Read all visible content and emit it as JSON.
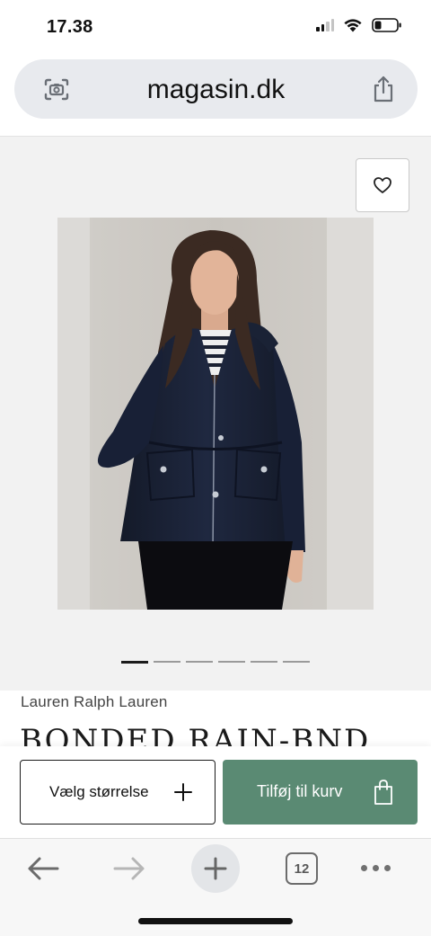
{
  "status_bar": {
    "time": "17.38"
  },
  "browser": {
    "url": "magasin.dk",
    "tab_count": "12"
  },
  "gallery": {
    "image_count": 6,
    "active_index": 0
  },
  "product": {
    "brand": "Lauren Ralph Lauren",
    "title": "BONDED RAIN-BND"
  },
  "actions": {
    "size_label": "Vælg størrelse",
    "cart_label": "Tilføj til kurv"
  },
  "colors": {
    "cart_button": "#5a8a73",
    "url_bar": "#e8eaee",
    "gallery_bg": "#f2f2f2"
  }
}
